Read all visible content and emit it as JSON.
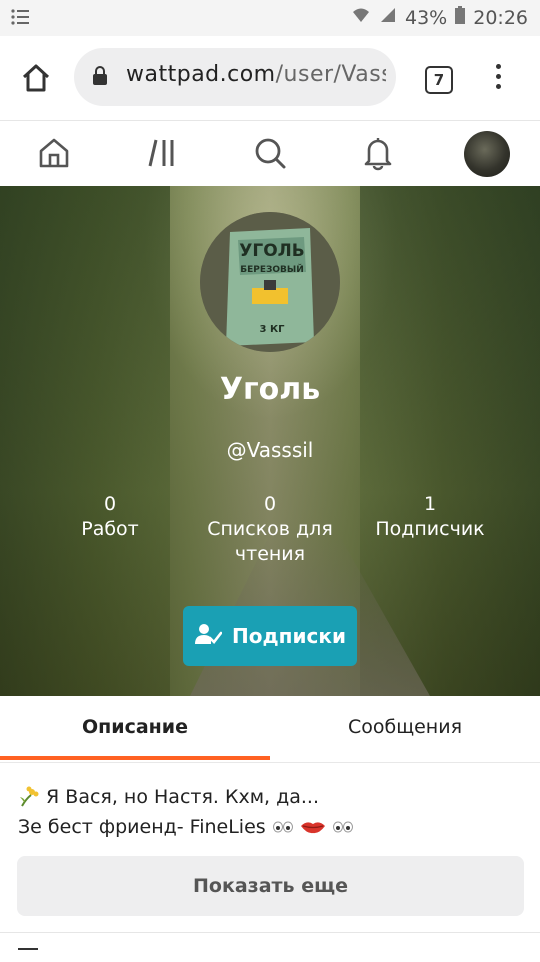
{
  "status_bar": {
    "menu_icon": "list-icon",
    "battery_percent": "43%",
    "time": "20:26"
  },
  "browser": {
    "url_domain": "wattpad.com",
    "url_path": "/user/Vasssi",
    "tab_count": "7"
  },
  "wattpad_nav": {
    "items": [
      "home-icon",
      "library-icon",
      "search-icon",
      "bell-icon",
      "avatar"
    ]
  },
  "profile": {
    "display_name": "Уголь",
    "username": "@Vasssil",
    "stats": [
      {
        "value": "0",
        "label": "Работ"
      },
      {
        "value": "0",
        "label": "Списков для чтения"
      },
      {
        "value": "1",
        "label": "Подписчик"
      }
    ],
    "follow_button": "Подписки",
    "profile_pic_text": [
      "УГОЛЬ",
      "БЕРЕЗОВЫЙ",
      "3 КГ"
    ]
  },
  "tabs": [
    {
      "label": "Описание",
      "active": true
    },
    {
      "label": "Сообщения",
      "active": false
    }
  ],
  "bio": {
    "line1": "Я Вася, но Настя. Кхм, да...",
    "line2": "Зе бест фриенд- FineLies"
  },
  "show_more": "Показать еще",
  "colors": {
    "accent": "#ff6122",
    "button_teal": "#1aa0b4"
  }
}
